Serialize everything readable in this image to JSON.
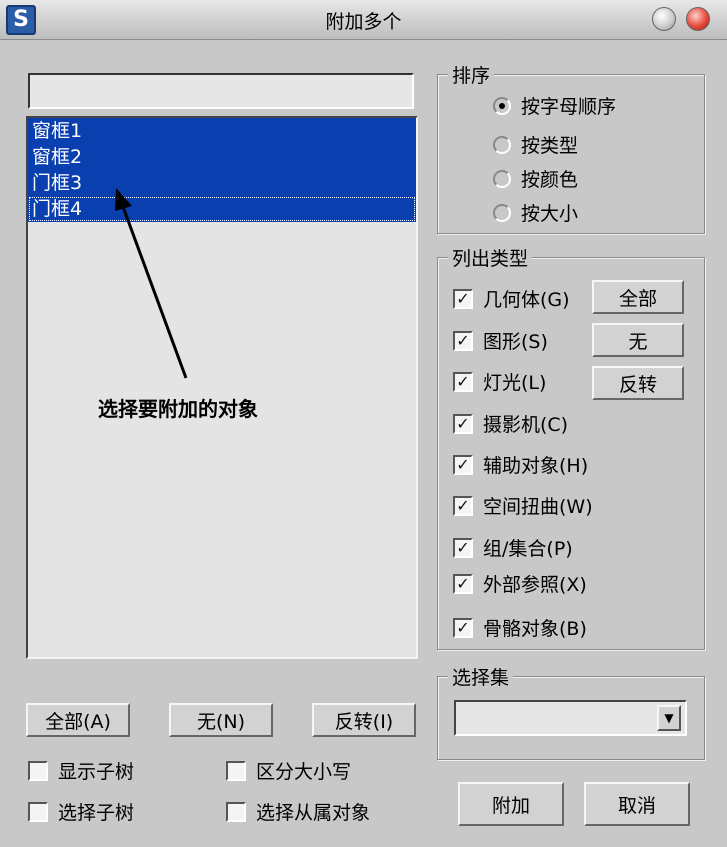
{
  "window": {
    "title": "附加多个",
    "app_icon": "max-logo-icon"
  },
  "search": {
    "value": ""
  },
  "object_list": [
    {
      "label": "窗框1",
      "selected": true
    },
    {
      "label": "窗框2",
      "selected": true
    },
    {
      "label": "门框3",
      "selected": true
    },
    {
      "label": "门框4",
      "selected": true
    }
  ],
  "annotation": {
    "text": "选择要附加的对象"
  },
  "bottom_buttons": {
    "all": "全部(A)",
    "none": "无(N)",
    "invert": "反转(I)"
  },
  "bottom_checks": {
    "show_subtree": {
      "label": "显示子树",
      "checked": false
    },
    "case_sensitive": {
      "label": "区分大小写",
      "checked": false
    },
    "select_subtree": {
      "label": "选择子树",
      "checked": false
    },
    "select_dependents": {
      "label": "选择从属对象",
      "checked": false
    }
  },
  "sort": {
    "title": "排序",
    "options": [
      {
        "label": "按字母顺序",
        "selected": true
      },
      {
        "label": "按类型",
        "selected": false
      },
      {
        "label": "按颜色",
        "selected": false
      },
      {
        "label": "按大小",
        "selected": false
      }
    ]
  },
  "list_types": {
    "title": "列出类型",
    "items": [
      {
        "label": "几何体(G)",
        "checked": true
      },
      {
        "label": "图形(S)",
        "checked": true
      },
      {
        "label": "灯光(L)",
        "checked": true
      },
      {
        "label": "摄影机(C)",
        "checked": true
      },
      {
        "label": "辅助对象(H)",
        "checked": true
      },
      {
        "label": "空间扭曲(W)",
        "checked": true
      },
      {
        "label": "组/集合(P)",
        "checked": true
      },
      {
        "label": "外部参照(X)",
        "checked": true
      },
      {
        "label": "骨骼对象(B)",
        "checked": true
      }
    ],
    "buttons": {
      "all": "全部",
      "none": "无",
      "invert": "反转"
    }
  },
  "selection_set": {
    "title": "选择集",
    "value": ""
  },
  "actions": {
    "attach": "附加",
    "cancel": "取消"
  },
  "colors": {
    "selection": "#0a3fb0",
    "background": "#c8c8c8"
  }
}
